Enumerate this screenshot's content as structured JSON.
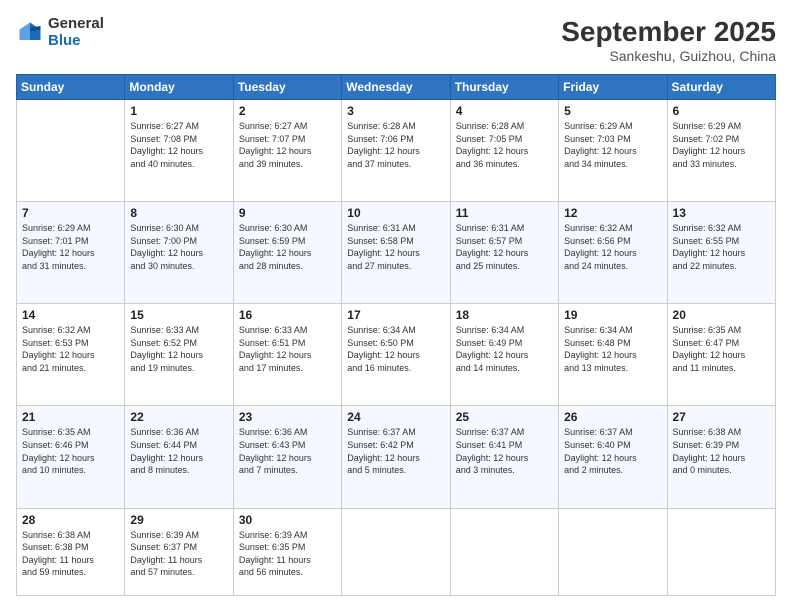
{
  "header": {
    "logo": {
      "general": "General",
      "blue": "Blue"
    },
    "title": "September 2025",
    "subtitle": "Sankeshu, Guizhou, China"
  },
  "weekdays": [
    "Sunday",
    "Monday",
    "Tuesday",
    "Wednesday",
    "Thursday",
    "Friday",
    "Saturday"
  ],
  "weeks": [
    [
      {
        "day": "",
        "info": ""
      },
      {
        "day": "1",
        "info": "Sunrise: 6:27 AM\nSunset: 7:08 PM\nDaylight: 12 hours\nand 40 minutes."
      },
      {
        "day": "2",
        "info": "Sunrise: 6:27 AM\nSunset: 7:07 PM\nDaylight: 12 hours\nand 39 minutes."
      },
      {
        "day": "3",
        "info": "Sunrise: 6:28 AM\nSunset: 7:06 PM\nDaylight: 12 hours\nand 37 minutes."
      },
      {
        "day": "4",
        "info": "Sunrise: 6:28 AM\nSunset: 7:05 PM\nDaylight: 12 hours\nand 36 minutes."
      },
      {
        "day": "5",
        "info": "Sunrise: 6:29 AM\nSunset: 7:03 PM\nDaylight: 12 hours\nand 34 minutes."
      },
      {
        "day": "6",
        "info": "Sunrise: 6:29 AM\nSunset: 7:02 PM\nDaylight: 12 hours\nand 33 minutes."
      }
    ],
    [
      {
        "day": "7",
        "info": "Sunrise: 6:29 AM\nSunset: 7:01 PM\nDaylight: 12 hours\nand 31 minutes."
      },
      {
        "day": "8",
        "info": "Sunrise: 6:30 AM\nSunset: 7:00 PM\nDaylight: 12 hours\nand 30 minutes."
      },
      {
        "day": "9",
        "info": "Sunrise: 6:30 AM\nSunset: 6:59 PM\nDaylight: 12 hours\nand 28 minutes."
      },
      {
        "day": "10",
        "info": "Sunrise: 6:31 AM\nSunset: 6:58 PM\nDaylight: 12 hours\nand 27 minutes."
      },
      {
        "day": "11",
        "info": "Sunrise: 6:31 AM\nSunset: 6:57 PM\nDaylight: 12 hours\nand 25 minutes."
      },
      {
        "day": "12",
        "info": "Sunrise: 6:32 AM\nSunset: 6:56 PM\nDaylight: 12 hours\nand 24 minutes."
      },
      {
        "day": "13",
        "info": "Sunrise: 6:32 AM\nSunset: 6:55 PM\nDaylight: 12 hours\nand 22 minutes."
      }
    ],
    [
      {
        "day": "14",
        "info": "Sunrise: 6:32 AM\nSunset: 6:53 PM\nDaylight: 12 hours\nand 21 minutes."
      },
      {
        "day": "15",
        "info": "Sunrise: 6:33 AM\nSunset: 6:52 PM\nDaylight: 12 hours\nand 19 minutes."
      },
      {
        "day": "16",
        "info": "Sunrise: 6:33 AM\nSunset: 6:51 PM\nDaylight: 12 hours\nand 17 minutes."
      },
      {
        "day": "17",
        "info": "Sunrise: 6:34 AM\nSunset: 6:50 PM\nDaylight: 12 hours\nand 16 minutes."
      },
      {
        "day": "18",
        "info": "Sunrise: 6:34 AM\nSunset: 6:49 PM\nDaylight: 12 hours\nand 14 minutes."
      },
      {
        "day": "19",
        "info": "Sunrise: 6:34 AM\nSunset: 6:48 PM\nDaylight: 12 hours\nand 13 minutes."
      },
      {
        "day": "20",
        "info": "Sunrise: 6:35 AM\nSunset: 6:47 PM\nDaylight: 12 hours\nand 11 minutes."
      }
    ],
    [
      {
        "day": "21",
        "info": "Sunrise: 6:35 AM\nSunset: 6:46 PM\nDaylight: 12 hours\nand 10 minutes."
      },
      {
        "day": "22",
        "info": "Sunrise: 6:36 AM\nSunset: 6:44 PM\nDaylight: 12 hours\nand 8 minutes."
      },
      {
        "day": "23",
        "info": "Sunrise: 6:36 AM\nSunset: 6:43 PM\nDaylight: 12 hours\nand 7 minutes."
      },
      {
        "day": "24",
        "info": "Sunrise: 6:37 AM\nSunset: 6:42 PM\nDaylight: 12 hours\nand 5 minutes."
      },
      {
        "day": "25",
        "info": "Sunrise: 6:37 AM\nSunset: 6:41 PM\nDaylight: 12 hours\nand 3 minutes."
      },
      {
        "day": "26",
        "info": "Sunrise: 6:37 AM\nSunset: 6:40 PM\nDaylight: 12 hours\nand 2 minutes."
      },
      {
        "day": "27",
        "info": "Sunrise: 6:38 AM\nSunset: 6:39 PM\nDaylight: 12 hours\nand 0 minutes."
      }
    ],
    [
      {
        "day": "28",
        "info": "Sunrise: 6:38 AM\nSunset: 6:38 PM\nDaylight: 11 hours\nand 59 minutes."
      },
      {
        "day": "29",
        "info": "Sunrise: 6:39 AM\nSunset: 6:37 PM\nDaylight: 11 hours\nand 57 minutes."
      },
      {
        "day": "30",
        "info": "Sunrise: 6:39 AM\nSunset: 6:35 PM\nDaylight: 11 hours\nand 56 minutes."
      },
      {
        "day": "",
        "info": ""
      },
      {
        "day": "",
        "info": ""
      },
      {
        "day": "",
        "info": ""
      },
      {
        "day": "",
        "info": ""
      }
    ]
  ]
}
